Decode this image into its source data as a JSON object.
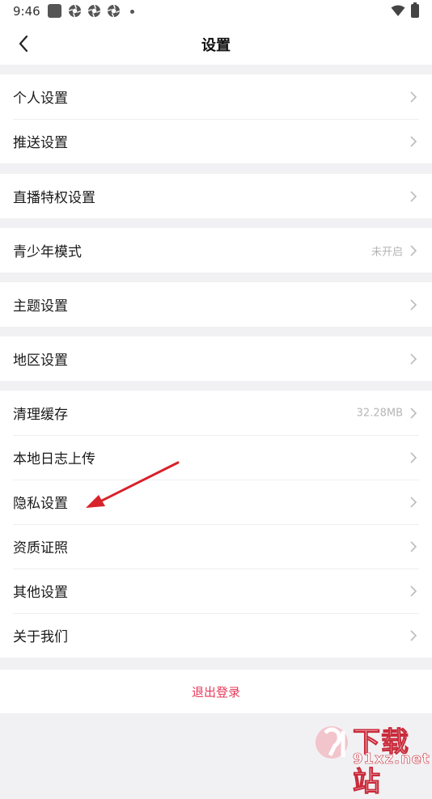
{
  "statusbar": {
    "time": "9:46",
    "icons": [
      "notification-square-icon",
      "aperture-icon",
      "aperture-icon",
      "aperture-icon",
      "dot-icon",
      "wifi-icon",
      "battery-icon"
    ]
  },
  "header": {
    "title": "设置",
    "back_icon": "chevron-left-icon"
  },
  "groups": [
    {
      "items": [
        {
          "label": "个人设置"
        },
        {
          "label": "推送设置"
        }
      ]
    },
    {
      "items": [
        {
          "label": "直播特权设置"
        }
      ]
    },
    {
      "items": [
        {
          "label": "青少年模式",
          "value": "未开启"
        }
      ]
    },
    {
      "items": [
        {
          "label": "主题设置"
        }
      ]
    },
    {
      "items": [
        {
          "label": "地区设置"
        }
      ]
    },
    {
      "items": [
        {
          "label": "清理缓存",
          "value": "32.28MB"
        },
        {
          "label": "本地日志上传"
        },
        {
          "label": "隐私设置"
        },
        {
          "label": "资质证照"
        },
        {
          "label": "其他设置"
        },
        {
          "label": "关于我们"
        }
      ]
    }
  ],
  "logout": {
    "label": "退出登录"
  },
  "annotation": {
    "arrow_target": "隐私设置",
    "arrow_color": "#d8222a"
  },
  "watermark": {
    "line1": "下载站",
    "line2": "91xz.net",
    "logo": "91"
  },
  "colors": {
    "accent": "#e8395a",
    "background": "#f1f1f3",
    "divider": "#efefef"
  }
}
